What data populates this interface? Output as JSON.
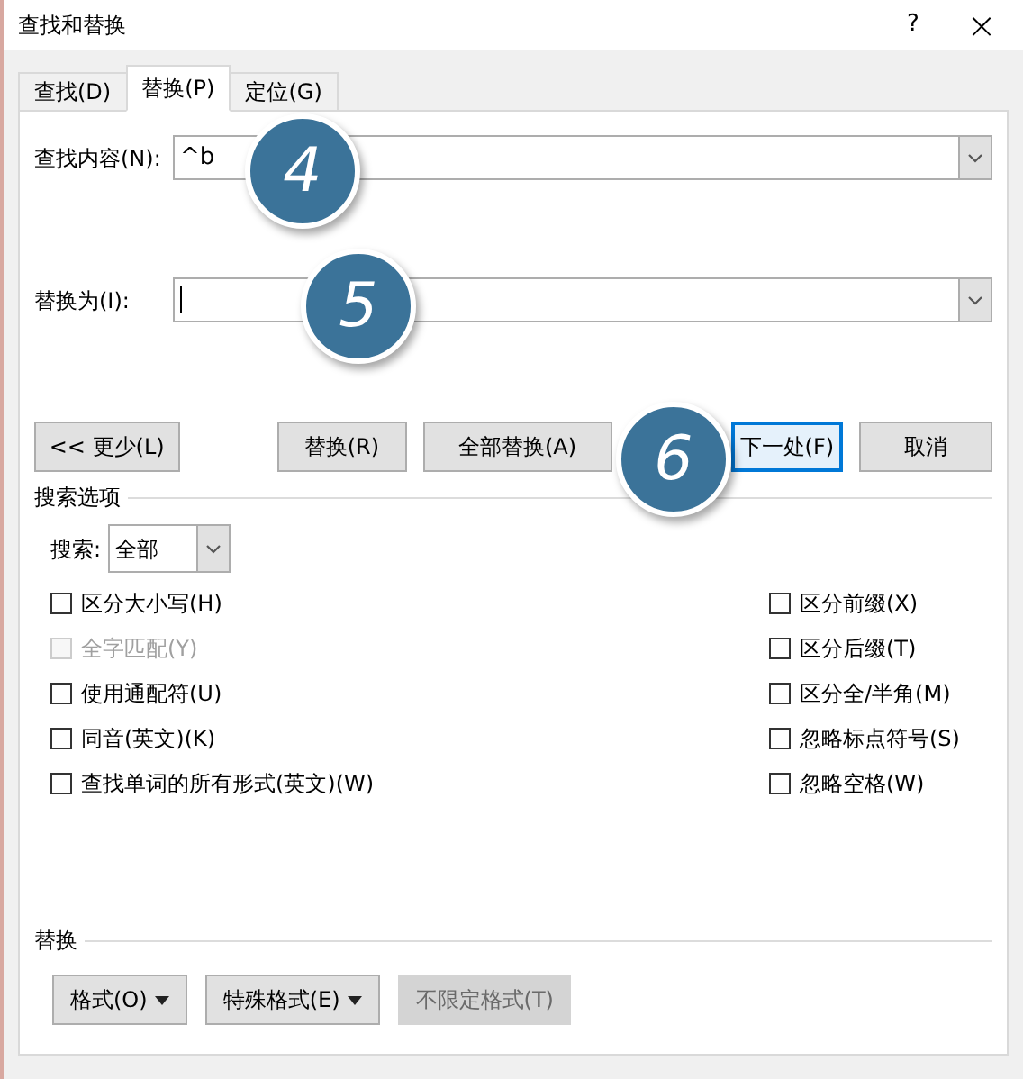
{
  "window": {
    "title": "查找和替换",
    "help": "?",
    "close": "×"
  },
  "tabs": [
    {
      "label": "查找(D)",
      "selected": false
    },
    {
      "label": "替换(P)",
      "selected": true
    },
    {
      "label": "定位(G)",
      "selected": false
    }
  ],
  "find": {
    "label": "查找内容(N):",
    "value": "^b"
  },
  "replace": {
    "label": "替换为(I):"
  },
  "buttons": [
    {
      "label": "<< 更少(L)",
      "default": false
    },
    {
      "label": "替换(R)",
      "default": false
    },
    {
      "label": "全部替换(A)",
      "default": false
    },
    {
      "label": "下一处(F)",
      "default": true
    },
    {
      "label": "取消",
      "default": false
    }
  ],
  "search_options": {
    "title": "搜索选项",
    "search_label": "搜索:",
    "search_value": "全部"
  },
  "options_left": [
    {
      "label": "区分大小写(H)",
      "checked": false,
      "disabled": false
    },
    {
      "label": "全字匹配(Y)",
      "checked": false,
      "disabled": true
    },
    {
      "label": "使用通配符(U)",
      "checked": false,
      "disabled": false
    },
    {
      "label": "同音(英文)(K)",
      "checked": false,
      "disabled": false
    },
    {
      "label": "查找单词的所有形式(英文)(W)",
      "checked": false,
      "disabled": false
    }
  ],
  "options_right": [
    {
      "label": "区分前缀(X)",
      "checked": false,
      "disabled": false
    },
    {
      "label": "区分后缀(T)",
      "checked": false,
      "disabled": false
    },
    {
      "label": "区分全/半角(M)",
      "checked": false,
      "disabled": false
    },
    {
      "label": "忽略标点符号(S)",
      "checked": false,
      "disabled": false
    },
    {
      "label": "忽略空格(W)",
      "checked": false,
      "disabled": false
    }
  ],
  "replace_section": {
    "title": "替换",
    "buttons": [
      {
        "label": "格式(O)",
        "dropdown": true,
        "disabled": false
      },
      {
        "label": "特殊格式(E)",
        "dropdown": true,
        "disabled": false
      },
      {
        "label": "不限定格式(T)",
        "dropdown": false,
        "disabled": true
      }
    ]
  },
  "callouts": [
    "4",
    "5",
    "6"
  ]
}
